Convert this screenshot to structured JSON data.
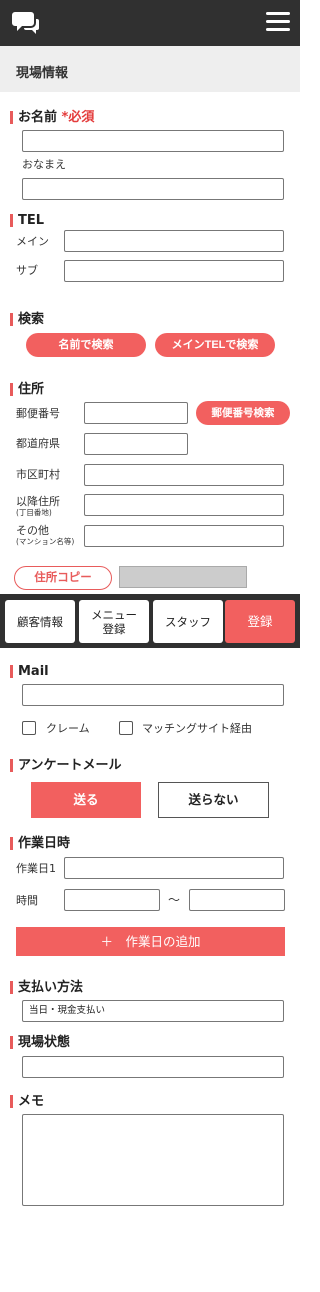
{
  "header": {
    "logo_icon": "chat-bubbles-icon",
    "menu_icon": "hamburger-icon"
  },
  "page_title": "現場情報",
  "name_section": {
    "title": "お名前",
    "required": "*必須",
    "kana_label": "おなまえ",
    "name_value": "",
    "kana_value": ""
  },
  "tel_section": {
    "title": "TEL",
    "main_label": "メイン",
    "sub_label": "サブ",
    "main_value": "",
    "sub_value": ""
  },
  "search_section": {
    "title": "検索",
    "by_name": "名前で検索",
    "by_tel": "メインTELで検索"
  },
  "address_section": {
    "title": "住所",
    "zip_label": "郵便番号",
    "zip_search": "郵便番号検索",
    "pref_label": "都道府県",
    "city_label": "市区町村",
    "after_label": "以降住所",
    "after_note": "(丁目番地)",
    "other_label": "その他",
    "other_note": "(マンション名等)",
    "copy_button": "住所コピー"
  },
  "bottom_nav": {
    "customer": "顧客情報",
    "menu_line1": "メニュー",
    "menu_line2": "登録",
    "staff": "スタッフ",
    "register": "登録"
  },
  "mail_section": {
    "title": "Mail",
    "value": "",
    "claim_label": "クレーム",
    "matching_label": "マッチングサイト経由"
  },
  "survey_section": {
    "title": "アンケートメール",
    "send": "送る",
    "no_send": "送らない"
  },
  "work_section": {
    "title": "作業日時",
    "date_label": "作業日1",
    "time_label": "時間",
    "tilde": "〜",
    "add_button": "＋　作業日の追加"
  },
  "payment_section": {
    "title": "支払い方法",
    "selected": "当日・現金支払い"
  },
  "status_section": {
    "title": "現場状態"
  },
  "memo_section": {
    "title": "メモ"
  },
  "colors": {
    "accent": "#f2605f",
    "topbar": "#303030",
    "header_bg": "#eeeeee"
  }
}
